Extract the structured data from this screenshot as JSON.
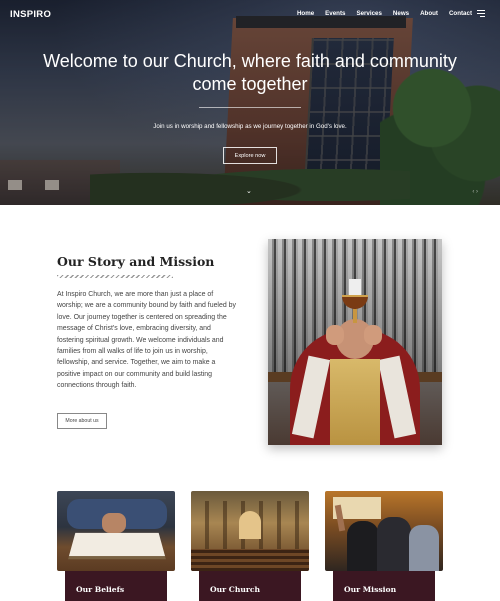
{
  "nav": {
    "logo": "INSPIRO",
    "links": [
      "Home",
      "Events",
      "Services",
      "News",
      "About",
      "Contact"
    ]
  },
  "hero": {
    "title": "Welcome to our Church, where faith and community come together",
    "subtitle": "Join us in worship and fellowship as we journey together in God's love.",
    "button": "Explore now"
  },
  "story": {
    "title": "Our Story and Mission",
    "body": "At Inspiro Church, we are more than just a place of worship; we are a community bound by faith and fueled by love. Our journey together is centered on spreading the message of Christ's love, embracing diversity, and fostering spiritual growth. We welcome individuals and families from all walks of life to join us in worship, fellowship, and service. Together, we aim to make a positive impact on our community and build lasting connections through faith.",
    "button": "More about us"
  },
  "cards": [
    {
      "label": "Our Beliefs"
    },
    {
      "label": "Our Church"
    },
    {
      "label": "Our Mission"
    }
  ],
  "colors": {
    "card_label_bg": "#3b1722",
    "text_dark": "#222222"
  },
  "icons": {
    "menu": "hamburger-icon",
    "scroll": "chevron-down-icon"
  }
}
